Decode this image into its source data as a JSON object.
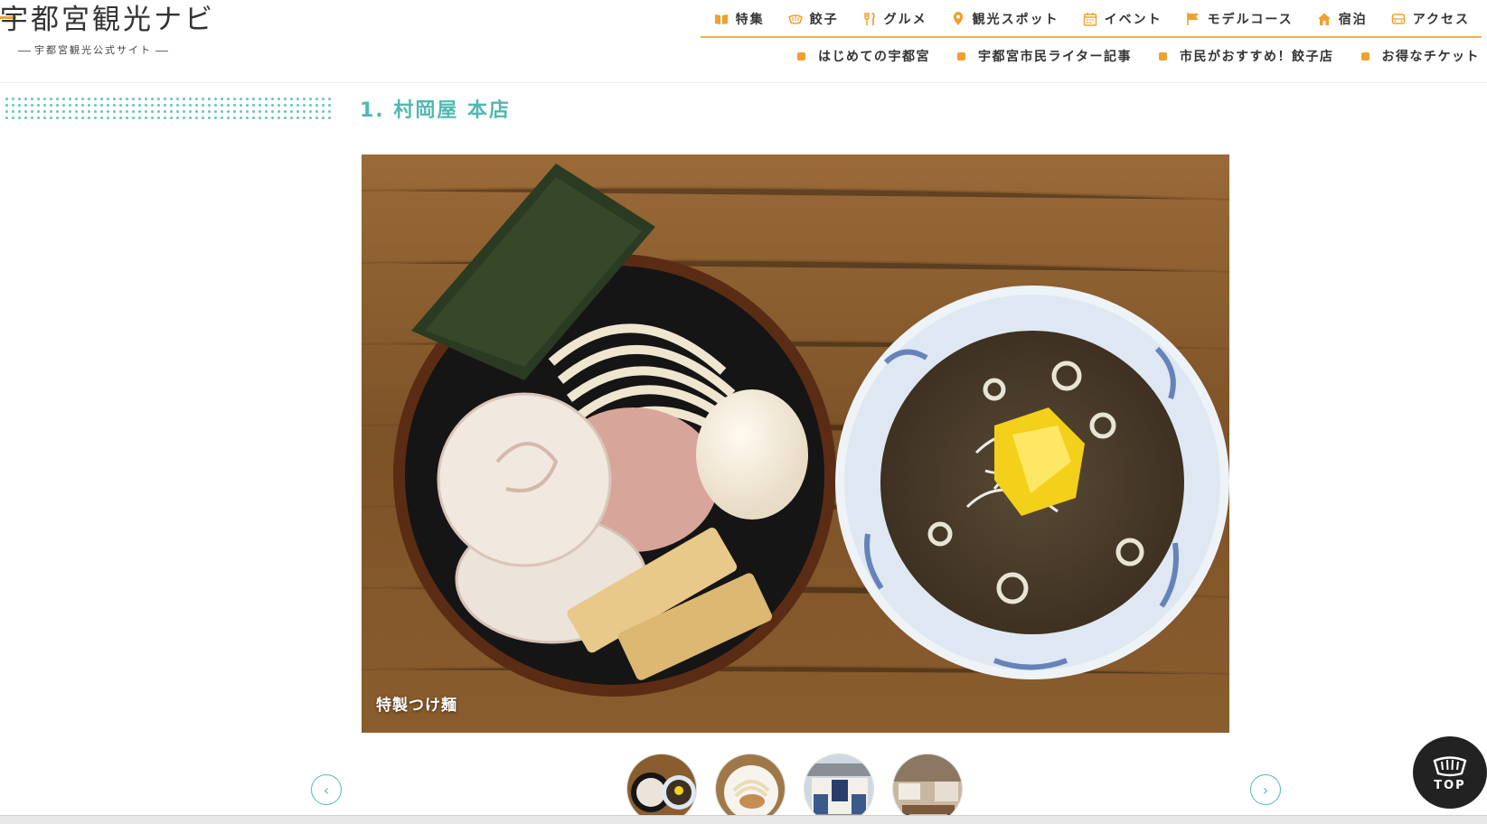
{
  "header": {
    "logo_title": "宇都宮観光ナビ",
    "logo_subtitle": "宇都宮観光公式サイト",
    "nav": [
      {
        "label": "特集",
        "icon": "book-icon"
      },
      {
        "label": "餃子",
        "icon": "gyoza-icon"
      },
      {
        "label": "グルメ",
        "icon": "fork-knife-icon"
      },
      {
        "label": "観光スポット",
        "icon": "map-pin-icon"
      },
      {
        "label": "イベント",
        "icon": "calendar-icon"
      },
      {
        "label": "モデルコース",
        "icon": "flag-icon"
      },
      {
        "label": "宿泊",
        "icon": "house-icon"
      },
      {
        "label": "アクセス",
        "icon": "train-icon"
      }
    ],
    "subnav": [
      {
        "label": "はじめての宇都宮"
      },
      {
        "label": "宇都宮市民ライター記事"
      },
      {
        "label": "市民がおすすめ！餃子店"
      },
      {
        "label": "お得なチケット"
      }
    ],
    "accent_color": "#f0a030"
  },
  "section": {
    "title": "1. 村岡屋 本店",
    "title_color": "#52b8b0"
  },
  "gallery": {
    "main_caption": "特製つけ麺",
    "prev_label": "‹",
    "next_label": "›",
    "thumbnails": [
      {
        "name": "tsukemen-thumb"
      },
      {
        "name": "noodle-thumb"
      },
      {
        "name": "storefront-thumb"
      },
      {
        "name": "interior-thumb"
      }
    ]
  },
  "top_button": {
    "label": "TOP"
  }
}
